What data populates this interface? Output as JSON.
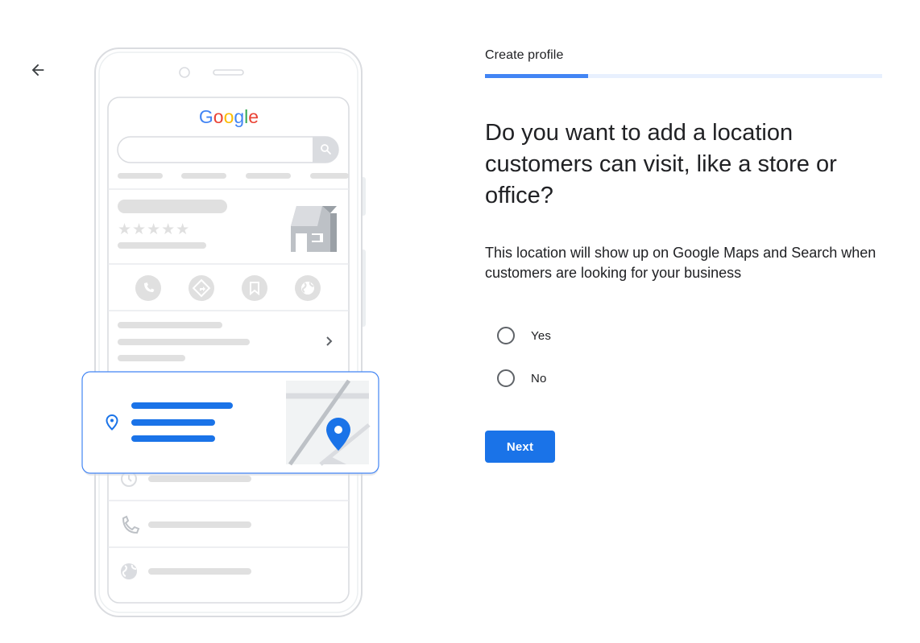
{
  "header": {
    "back_icon": "arrow-left-icon",
    "step_title": "Create profile",
    "progress_fraction": 0.26
  },
  "illustration": {
    "brand_text": "Google",
    "brand_colors": [
      "#4285F4",
      "#EA4335",
      "#FBBC05",
      "#4285F4",
      "#34A853",
      "#EA4335"
    ],
    "rating_stars": "★★★★★",
    "icons": [
      "search-icon",
      "store-icon",
      "phone-icon",
      "directions-icon",
      "bookmark-icon",
      "globe-icon",
      "chevron-right-icon",
      "location-pin-icon",
      "map-pin-icon",
      "clock-icon",
      "phone-icon",
      "globe-icon"
    ]
  },
  "main": {
    "question": "Do you want to add a location customers can visit, like a store or office?",
    "description": "This location will show up on Google Maps and Search when customers are looking for your business",
    "options": [
      {
        "label": "Yes",
        "selected": false
      },
      {
        "label": "No",
        "selected": false
      }
    ],
    "next_label": "Next"
  },
  "colors": {
    "accent": "#1a73e8",
    "progress_track": "#e8f0fe",
    "progress_fill": "#4285f4"
  }
}
